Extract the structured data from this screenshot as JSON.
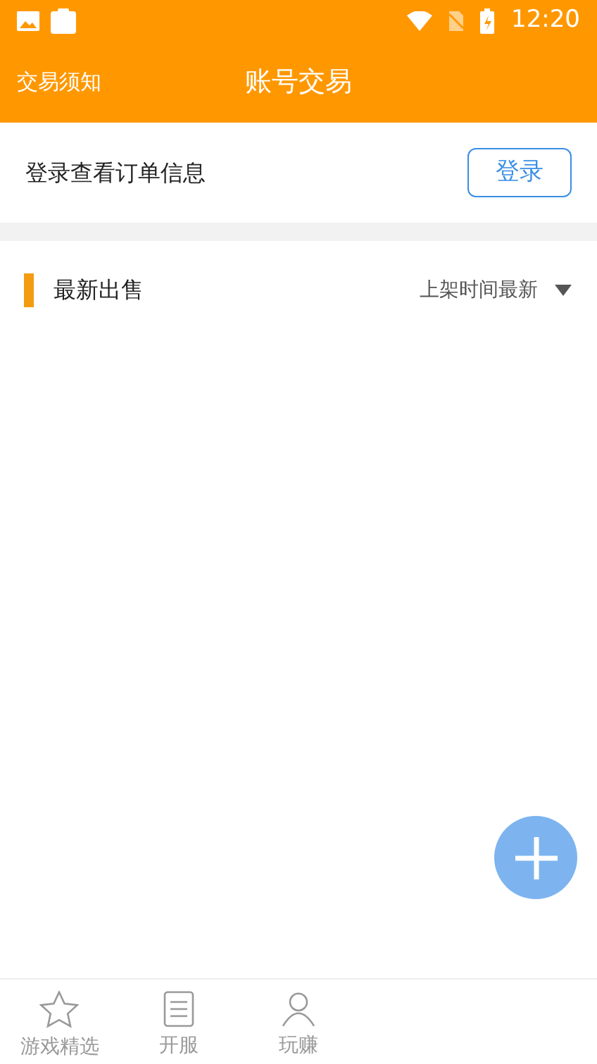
{
  "status_bar": {
    "time": "12:20"
  },
  "header": {
    "left_link": "交易须知",
    "title": "账号交易"
  },
  "login_bar": {
    "text": "登录查看订单信息",
    "button": "登录"
  },
  "section": {
    "title": "最新出售",
    "sort": "上架时间最新"
  },
  "tab_bar": [
    {
      "kind": "star",
      "label": "游戏精选",
      "selected": false
    },
    {
      "kind": "list",
      "label": "开服",
      "selected": false
    },
    {
      "kind": "person",
      "label": "玩赚",
      "selected": false
    }
  ]
}
